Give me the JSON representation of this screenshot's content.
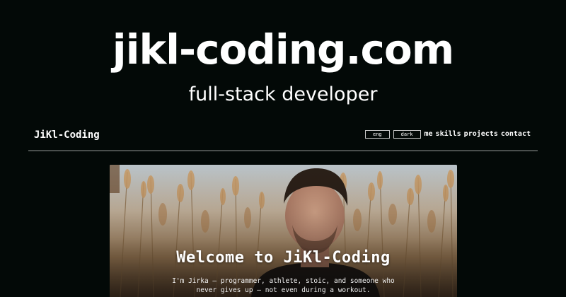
{
  "heading": {
    "title": "jikl-coding.com",
    "subtitle": "full-stack developer"
  },
  "site": {
    "brand": "JiKl-Coding",
    "toggles": [
      "eng",
      "dark"
    ],
    "nav": [
      "me",
      "skills",
      "projects",
      "contact"
    ]
  },
  "hero": {
    "title": "Welcome to JiKl-Coding",
    "description_lines": [
      "I'm Jirka – programmer, athlete, stoic, and someone who",
      "never gives up – not even during a workout."
    ]
  },
  "colors": {
    "background": "#030907",
    "divider": "#4a4f4d",
    "text": "#ffffff"
  }
}
